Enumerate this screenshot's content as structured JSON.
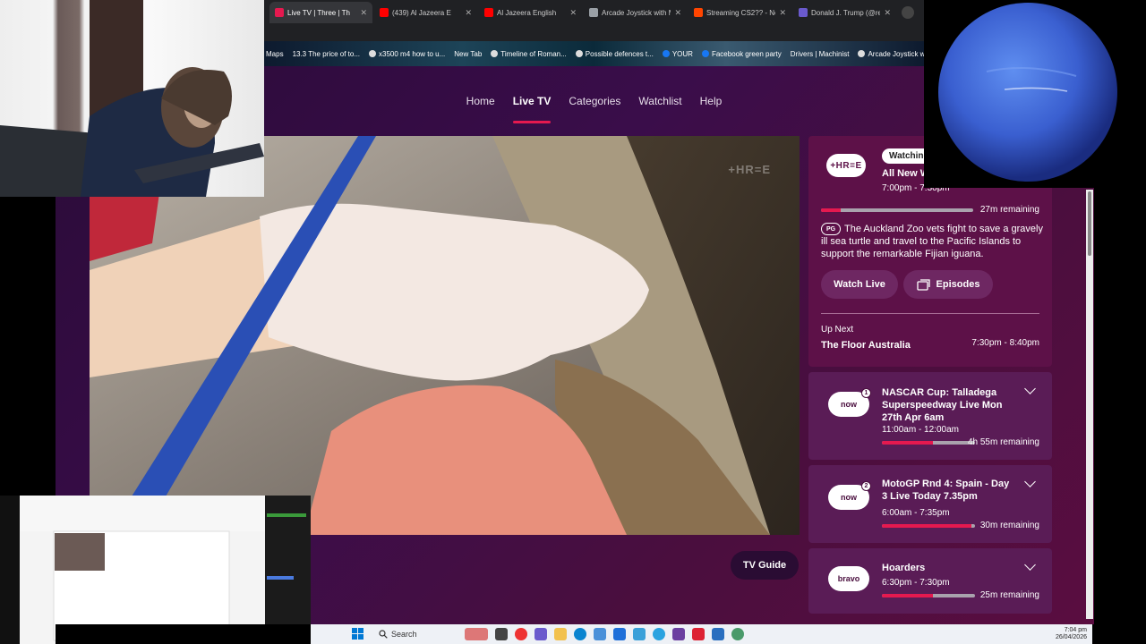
{
  "browser": {
    "tabs": [
      {
        "label": "Live TV | Three | Th",
        "active": true,
        "color": "#e5194f"
      },
      {
        "label": "(439) Al Jazeera E",
        "active": false,
        "color": "#ff0000"
      },
      {
        "label": "Al Jazeera English",
        "active": false,
        "color": "#ff0000"
      },
      {
        "label": "Arcade Joystick with M",
        "active": false,
        "color": "#9aa0a6"
      },
      {
        "label": "Streaming CS2?? - Not",
        "active": false,
        "color": "#ff4500"
      },
      {
        "label": "Donald J. Trump (@rea",
        "active": false,
        "color": "#6a5acd"
      }
    ],
    "close_glyph": "✕",
    "bookmarks": [
      "Maps",
      "13.3 The price of to...",
      "x3500 m4 how to u...",
      "New Tab",
      "Timeline of Roman...",
      "Possible defences t...",
      "YOUR",
      "Facebook green party",
      "Drivers | Machinist",
      "Arcade Joystick w"
    ]
  },
  "nav": {
    "items": [
      "Home",
      "Live TV",
      "Categories",
      "Watchlist",
      "Help"
    ],
    "active": "Live TV"
  },
  "player": {
    "watermark": "+HR=E",
    "tv_guide_label": "TV Guide"
  },
  "now": {
    "channel_logo": "+HR=E",
    "badge": "Watching",
    "title": "All New W",
    "time": "7:00pm - 7:30pm",
    "progress": 0.13,
    "remaining": "27m remaining",
    "rating": "PG",
    "description": "The Auckland Zoo vets fight to save a gravely ill sea turtle and travel to the Pacific Islands to support the remarkable Fijian iguana.",
    "watch_live_label": "Watch Live",
    "episodes_label": "Episodes",
    "up_next_label": "Up Next",
    "up_next_title": "The Floor Australia",
    "up_next_time": "7:30pm - 8:40pm"
  },
  "channels": [
    {
      "logo": "now",
      "number": "1",
      "title": "NASCAR Cup: Talladega Superspeedway Live Mon 27th Apr 6am",
      "time": "11:00am - 12:00am",
      "progress": 0.55,
      "remaining": "4h 55m remaining"
    },
    {
      "logo": "now",
      "number": "2",
      "title": "MotoGP Rnd 4: Spain - Day 3 Live Today 7.35pm",
      "time": "6:00am - 7:35pm",
      "progress": 0.96,
      "remaining": "30m remaining"
    },
    {
      "logo": "bravo",
      "number": "",
      "title": "Hoarders",
      "time": "6:30pm - 7:30pm",
      "progress": 0.55,
      "remaining": "25m remaining"
    }
  ],
  "taskbar": {
    "search_label": "Search",
    "time": "7:04 pm",
    "date": "26/04/2026"
  },
  "colors": {
    "accent": "#e5194f",
    "panel": "#5d1148",
    "card": "#5a1c56"
  }
}
